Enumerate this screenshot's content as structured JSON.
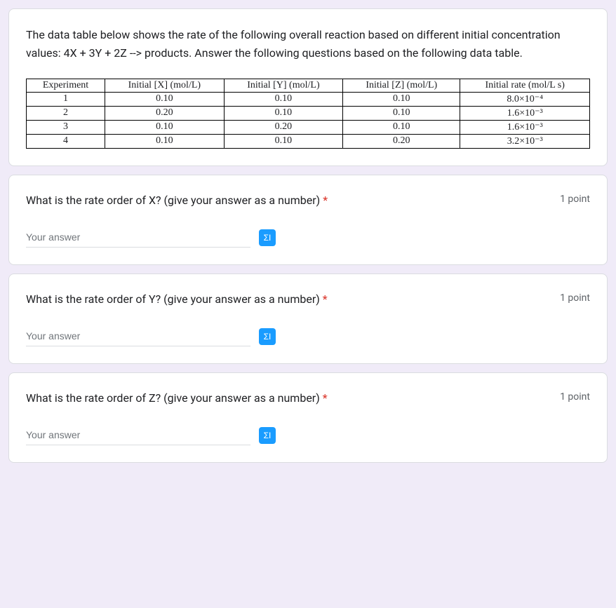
{
  "intro": "The data table below shows the rate of the following overall reaction based on different initial concentration values: 4X + 3Y + 2Z --> products. Answer the following questions based on the following data table.",
  "table": {
    "headers": [
      "Experiment",
      "Initial [X]  (mol/L)",
      "Initial [Y]  (mol/L)",
      "Initial [Z]  (mol/L)",
      "Initial rate  (mol/L s)"
    ],
    "rows": [
      [
        "1",
        "0.10",
        "0.10",
        "0.10",
        "8.0×10⁻⁴"
      ],
      [
        "2",
        "0.20",
        "0.10",
        "0.10",
        "1.6×10⁻³"
      ],
      [
        "3",
        "0.10",
        "0.20",
        "0.10",
        "1.6×10⁻³"
      ],
      [
        "4",
        "0.10",
        "0.10",
        "0.20",
        "3.2×10⁻³"
      ]
    ]
  },
  "questions": [
    {
      "text": "What is the rate order of X? (give your answer as a number)",
      "points": "1 point"
    },
    {
      "text": "What is the rate order of Y? (give your answer as a number)",
      "points": "1 point"
    },
    {
      "text": "What is the rate order of Z? (give your answer as a number)",
      "points": "1 point"
    }
  ],
  "placeholder": "Your answer",
  "required_marker": "*",
  "eq_label": "ΣΙ"
}
